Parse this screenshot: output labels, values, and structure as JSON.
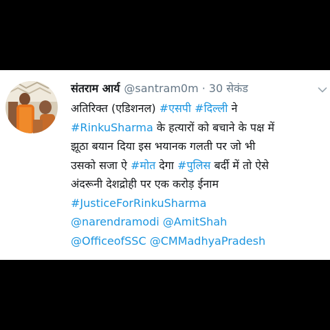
{
  "tweet": {
    "author_name": "संतराम आर्य",
    "handle": "@santram0m",
    "separator": "·",
    "time": "30 सेकंड",
    "avatar_icon": "profile-photo",
    "menu_icon": "chevron-down-icon",
    "lines": [
      [
        {
          "text": "अतिरिक्त (एडिशनल) ",
          "type": "text"
        },
        {
          "text": "#एसपी",
          "type": "link"
        },
        {
          "text": " ",
          "type": "text"
        },
        {
          "text": "#दिल्ली",
          "type": "link"
        },
        {
          "text": " ने",
          "type": "text"
        }
      ],
      [
        {
          "text": "#RinkuSharma",
          "type": "link"
        },
        {
          "text": "  के हत्यारों को बचाने के पक्ष में",
          "type": "text"
        }
      ],
      [
        {
          "text": "झूठा बयान दिया इस भयानक गलती पर जो भी",
          "type": "text"
        }
      ],
      [
        {
          "text": "उसको सजा ऐ ",
          "type": "text"
        },
        {
          "text": "#मोत",
          "type": "link"
        },
        {
          "text": " देगा ",
          "type": "text"
        },
        {
          "text": "#पुलिस",
          "type": "link"
        },
        {
          "text": " बर्दी में तो ऐसे",
          "type": "text"
        }
      ],
      [
        {
          "text": "अंदरूनी देशद्रोही पर एक करोड़ ईनाम",
          "type": "text"
        }
      ],
      [
        {
          "text": "#JusticeForRinkuSharma",
          "type": "link"
        }
      ],
      [
        {
          "text": "@narendramodi",
          "type": "link"
        },
        {
          "text": " ",
          "type": "text"
        },
        {
          "text": "@AmitShah",
          "type": "link"
        }
      ],
      [
        {
          "text": "@OfficeofSSC",
          "type": "link"
        },
        {
          "text": " ",
          "type": "text"
        },
        {
          "text": "@CMMadhyaPradesh",
          "type": "link"
        }
      ]
    ]
  },
  "colors": {
    "background": "#000000",
    "card": "#ffffff",
    "text": "#14171a",
    "muted": "#657786",
    "link": "#1b95e0"
  }
}
